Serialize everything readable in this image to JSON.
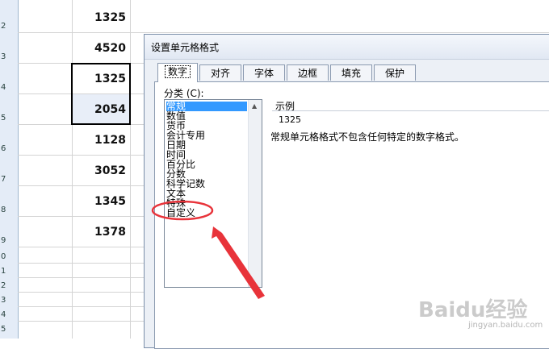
{
  "sheet": {
    "row_headers": [
      "2",
      "3",
      "4",
      "5",
      "6",
      "7",
      "8",
      "9",
      "0",
      "1",
      "2",
      "3",
      "4",
      "5"
    ],
    "values": [
      "1325",
      "4520",
      "1325",
      "2054",
      "1128",
      "3052",
      "1345",
      "1378"
    ]
  },
  "dialog": {
    "title": "设置单元格格式",
    "tabs": [
      "数字",
      "对齐",
      "字体",
      "边框",
      "填充",
      "保护"
    ],
    "category_label": "分类 (C):",
    "categories": [
      "常规",
      "数值",
      "货币",
      "会计专用",
      "日期",
      "时间",
      "百分比",
      "分数",
      "科学记数",
      "文本",
      "特殊",
      "自定义"
    ],
    "selected_category": "常规",
    "sample_label": "示例",
    "sample_value": "1325",
    "description": "常规单元格格式不包含任何特定的数字格式。"
  },
  "watermark": {
    "text": "Baidu经验",
    "url": "jingyan.baidu.com"
  },
  "colors": {
    "selection": "#3399ff",
    "annotation": "#e8333a",
    "row_header_bg": "#e4ecf7"
  }
}
